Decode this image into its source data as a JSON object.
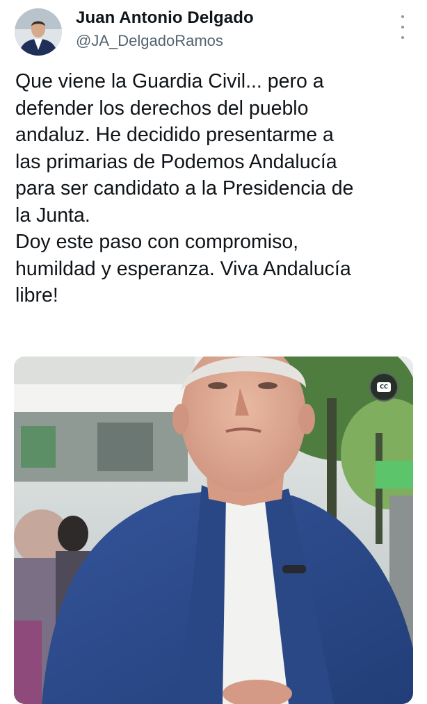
{
  "tweet": {
    "author": {
      "display_name": "Juan Antonio Delgado",
      "handle": "@JA_DelgadoRamos",
      "avatar_icon": "profile-photo"
    },
    "more_icon": "vertical-ellipsis-icon",
    "text_lines": [
      "Que viene la Guardia Civil... pero a",
      "defender los derechos del pueblo",
      "andaluz. He decidido presentarme a",
      "las primarias de Podemos Andalucía",
      "para ser candidato a la Presidencia de",
      "la Junta.",
      "Doy este paso con compromiso,",
      "humildad y esperanza. Viva Andalucía",
      "libre!"
    ],
    "media": {
      "type": "video",
      "captions_label": "CC"
    }
  },
  "colors": {
    "text_primary": "#0f1419",
    "text_secondary": "#536471",
    "jacket_blue": "#2c4a86",
    "shirt_white": "#f2f2f0"
  }
}
